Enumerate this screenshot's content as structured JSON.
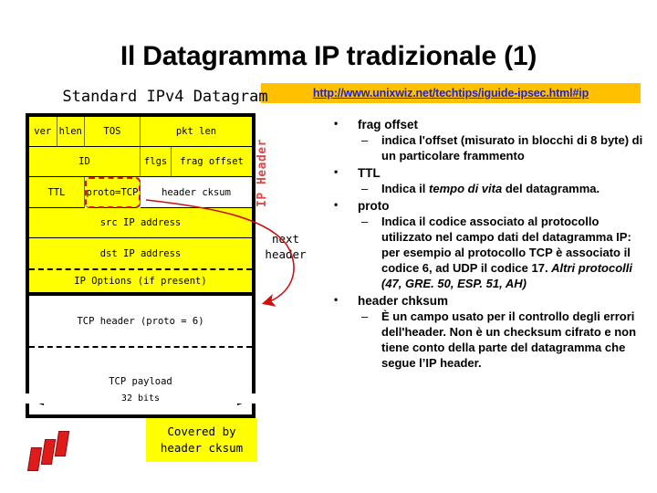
{
  "slide": {
    "title": "Il Datagramma IP tradizionale (1)"
  },
  "url_banner": {
    "text": "http://www.unixwiz.net/techtips/iguide-ipsec.html#ip",
    "background_color": "#FFC000",
    "link_color": "#2222CC"
  },
  "diagram": {
    "caption": "Standard IPv4 Datagram",
    "side_label": "IP Header",
    "next_header_label_line1": "next",
    "next_header_label_line2": "header",
    "measure_label": "32 bits",
    "covered_line1": "Covered by",
    "covered_line2": "header cksum",
    "highlight_color": "#E01010",
    "field_color": "#FFFF00",
    "rows": [
      {
        "cells": [
          {
            "label": "ver",
            "bits": 4
          },
          {
            "label": "hlen",
            "bits": 4
          },
          {
            "label": "TOS",
            "bits": 8
          },
          {
            "label": "pkt len",
            "bits": 16
          }
        ]
      },
      {
        "cells": [
          {
            "label": "ID",
            "bits": 16
          },
          {
            "label": "flgs",
            "bits": 3
          },
          {
            "label": "frag offset",
            "bits": 13
          }
        ]
      },
      {
        "cells": [
          {
            "label": "TTL",
            "bits": 8
          },
          {
            "label": "proto=TCP",
            "bits": 8,
            "highlighted": true
          },
          {
            "label": "header cksum",
            "bits": 16,
            "white": true
          }
        ]
      },
      {
        "cells": [
          {
            "label": "src IP address",
            "bits": 32
          }
        ]
      },
      {
        "cells": [
          {
            "label": "dst IP address",
            "bits": 32
          }
        ]
      },
      {
        "cells": [
          {
            "label": "IP Options (if present)",
            "bits": 32
          }
        ]
      },
      {
        "cells": [
          {
            "label": "TCP header (proto = 6)",
            "bits": 32,
            "white": true
          }
        ]
      },
      {
        "cells": [
          {
            "label": "TCP payload",
            "bits": 32,
            "white": true
          }
        ]
      }
    ]
  },
  "bullets": [
    {
      "level1": "frag offset",
      "level2_runs": [
        {
          "text": "indica l'offset (misurato in blocchi di 8 byte) di un particolare frammento",
          "italic": false
        }
      ]
    },
    {
      "level1": "TTL",
      "level2_runs": [
        {
          "text": "Indica il ",
          "italic": false
        },
        {
          "text": "tempo di vita",
          "italic": true
        },
        {
          "text": " del datagramma.",
          "italic": false
        }
      ]
    },
    {
      "level1": "proto",
      "level2_runs": [
        {
          "text": "Indica il codice associato al protocollo utilizzato nel campo dati del datagramma IP: per esempio al protocollo TCP è associato il codice 6, ad UDP il codice 17. ",
          "italic": false
        },
        {
          "text": "Altri protocolli (47, GRE. 50, ESP. 51, AH)",
          "italic": true
        }
      ]
    },
    {
      "level1": "header chksum",
      "level2_runs": [
        {
          "text": "È un campo usato per il controllo degli errori dell'header. Non è un checksum cifrato e non tiene conto della parte del datagramma che segue l’IP header.",
          "italic": false
        }
      ]
    }
  ],
  "bullet_markers": {
    "level1": "•",
    "level2": "–"
  }
}
